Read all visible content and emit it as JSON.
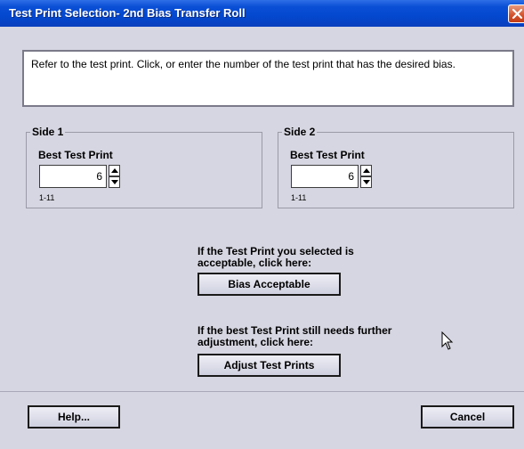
{
  "window": {
    "title": "Test Print Selection- 2nd Bias Transfer Roll"
  },
  "instructions": "Refer to the test print.  Click, or enter the number of the test print that has the desired bias.",
  "side1": {
    "legend": "Side 1",
    "field_label": "Best Test Print",
    "value": "6",
    "range": "1-11"
  },
  "side2": {
    "legend": "Side 2",
    "field_label": "Best Test Print",
    "value": "6",
    "range": "1-11"
  },
  "acceptable": {
    "prompt_line1": "If the Test Print you selected is",
    "prompt_line2": "acceptable, click here:",
    "button_label": "Bias Acceptable"
  },
  "adjust": {
    "prompt_line1": "If the best Test Print still needs further",
    "prompt_line2": "adjustment, click here:",
    "button_label": "Adjust Test Prints"
  },
  "footer": {
    "help_label": "Help...",
    "cancel_label": "Cancel"
  },
  "icons": {
    "close": "close-icon",
    "spin_up": "up-triangle",
    "spin_down": "down-triangle",
    "cursor": "mouse-pointer"
  }
}
